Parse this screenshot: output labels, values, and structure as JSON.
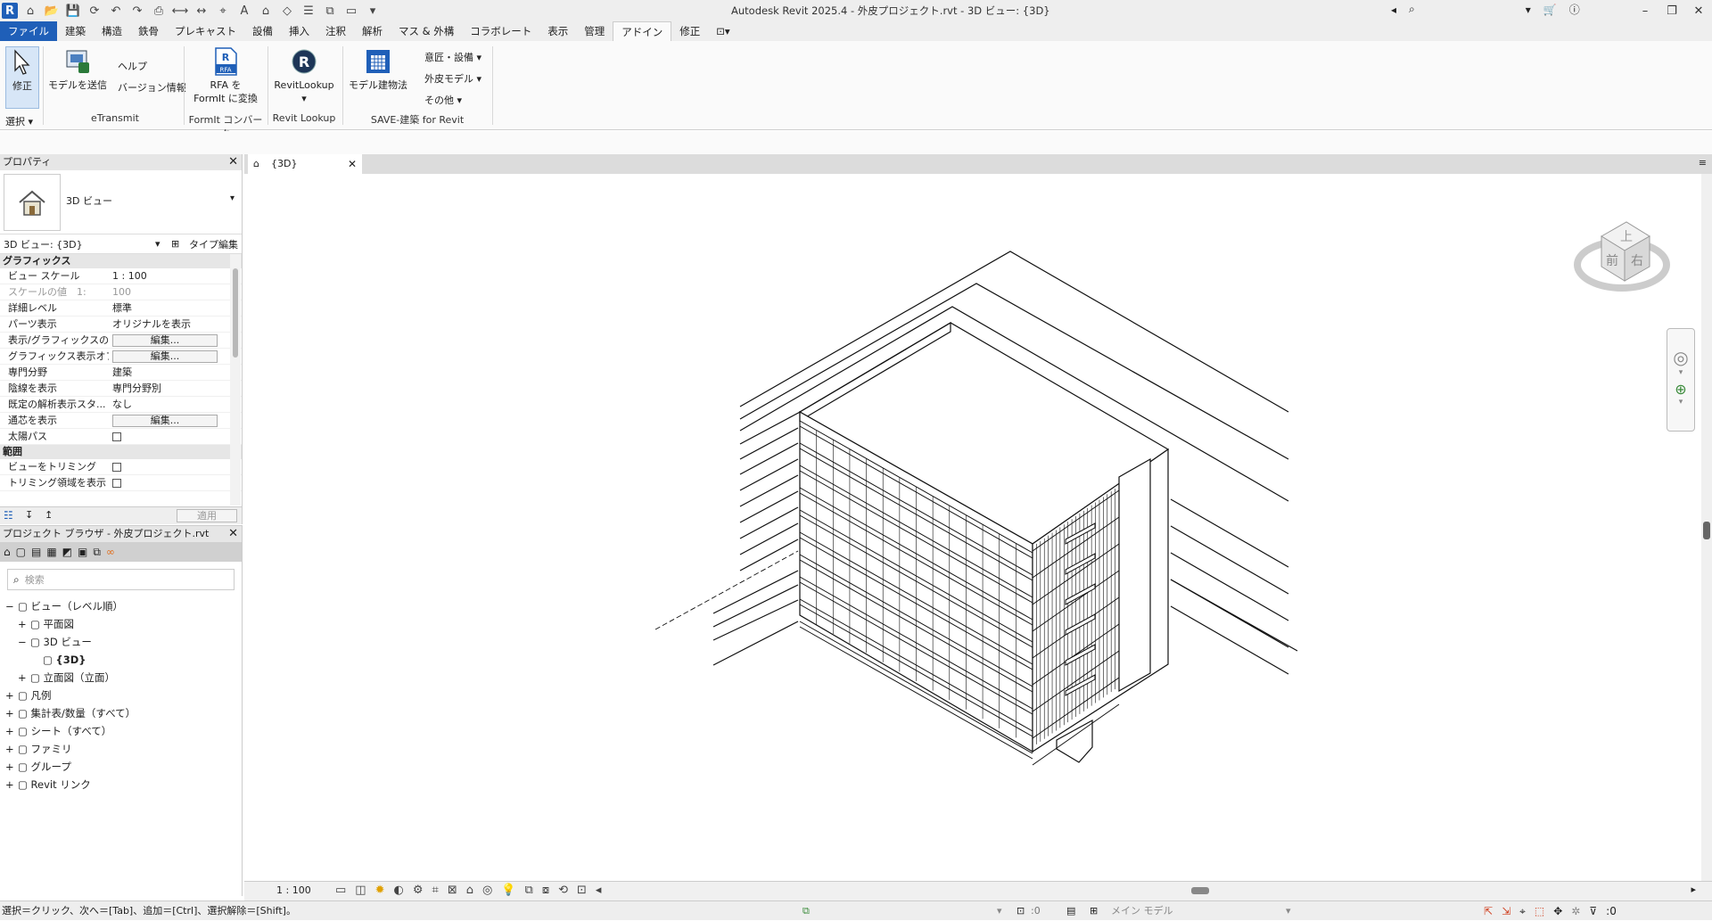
{
  "title": {
    "text": "Autodesk Revit 2025.4 - 外皮プロジェクト.rvt - 3D ビュー: {3D}"
  },
  "app_logo": "R",
  "menus": [
    "ファイル",
    "建築",
    "構造",
    "鉄骨",
    "プレキャスト",
    "設備",
    "挿入",
    "注釈",
    "解析",
    "マス & 外構",
    "コラボレート",
    "表示",
    "管理",
    "アドイン",
    "修正"
  ],
  "ribbon": {
    "modify": "修正",
    "select": "選択",
    "send_model": "モデルを送信",
    "help": "ヘルプ",
    "version": "バージョン情報",
    "etransmit": "eTransmit",
    "rfa_line1": "RFA を",
    "rfa_line2": "FormIt に変換",
    "rfa_badge": "RFA",
    "formit": "FormIt コンバータ",
    "revitlookup": "RevitLookup",
    "revitlookup_panel": "Revit Lookup",
    "model_build": "モデル建物法",
    "design_equip": "意匠・設備",
    "envelope_model": "外皮モデル",
    "other": "その他",
    "save_panel": "SAVE-建築 for Revit"
  },
  "properties": {
    "header": "プロパティ",
    "type_name": "3D ビュー",
    "selector": "3D ビュー: {3D}",
    "edit_type": "タイプ編集",
    "apply": "適用",
    "groups": [
      {
        "name": "グラフィックス",
        "rows": [
          {
            "k": "ビュー スケール",
            "v": "1 : 100"
          },
          {
            "k": "スケールの値　1:",
            "v": "100",
            "dim": true
          },
          {
            "k": "詳細レベル",
            "v": "標準"
          },
          {
            "k": "パーツ表示",
            "v": "オリジナルを表示"
          },
          {
            "k": "表示/グラフィックスの...",
            "btn": "編集..."
          },
          {
            "k": "グラフィックス表示オプ...",
            "btn": "編集..."
          },
          {
            "k": "専門分野",
            "v": "建築"
          },
          {
            "k": "陰線を表示",
            "v": "専門分野別"
          },
          {
            "k": "既定の解析表示スタ...",
            "v": "なし"
          },
          {
            "k": "通芯を表示",
            "btn": "編集..."
          },
          {
            "k": "太陽パス",
            "cb": true
          }
        ]
      },
      {
        "name": "範囲",
        "rows": [
          {
            "k": "ビューをトリミング",
            "cb": true
          },
          {
            "k": "トリミング領域を表示",
            "cb": true
          }
        ]
      }
    ]
  },
  "browser": {
    "header": "プロジェクト ブラウザ - 外皮プロジェクト.rvt",
    "search_placeholder": "検索",
    "items": [
      {
        "label": "ビュー（レベル順）",
        "level": 0,
        "exp": "−"
      },
      {
        "label": "平面図",
        "level": 1,
        "exp": "+"
      },
      {
        "label": "3D ビュー",
        "level": 1,
        "exp": "−"
      },
      {
        "label": "{3D}",
        "level": 2,
        "exp": "",
        "bold": true
      },
      {
        "label": "立面図（立面）",
        "level": 1,
        "exp": "+"
      },
      {
        "label": "凡例",
        "level": 0,
        "exp": "+"
      },
      {
        "label": "集計表/数量（すべて）",
        "level": 0,
        "exp": "+"
      },
      {
        "label": "シート（すべて）",
        "level": 0,
        "exp": "+"
      },
      {
        "label": "ファミリ",
        "level": 0,
        "exp": "+"
      },
      {
        "label": "グループ",
        "level": 0,
        "exp": "+"
      },
      {
        "label": "Revit リンク",
        "level": 0,
        "exp": "+"
      }
    ]
  },
  "view_tab": "{3D}",
  "viewcube": {
    "top": "上",
    "front": "前",
    "right": "右"
  },
  "view_scale": "1 : 100",
  "status": {
    "hint": "選択＝クリック、次へ＝[Tab]、追加＝[Ctrl]、選択解除＝[Shift]。",
    "zero1": ":0",
    "model": "メイン モデル",
    "filter_count": ":0"
  }
}
